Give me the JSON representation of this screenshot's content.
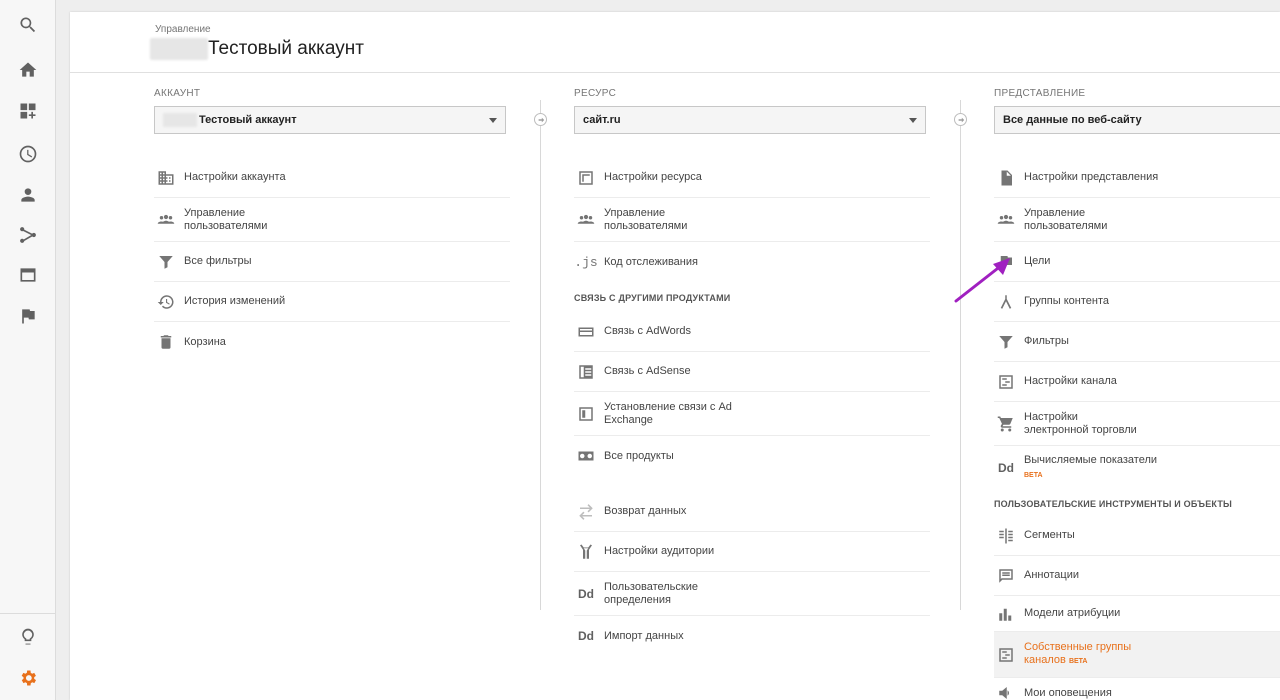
{
  "header": {
    "breadcrumb": "Управление",
    "title": "Тестовый аккаунт"
  },
  "nav_rail": [
    {
      "icon": "search-icon"
    },
    {
      "icon": "home-icon"
    },
    {
      "icon": "dashboard-icon"
    },
    {
      "icon": "clock-icon"
    },
    {
      "icon": "person-icon"
    },
    {
      "icon": "acquisition-icon"
    },
    {
      "icon": "browser-icon"
    },
    {
      "icon": "flag-icon"
    },
    {
      "icon": "lightbulb-icon"
    },
    {
      "icon": "gear-icon"
    }
  ],
  "account": {
    "label": "АККАУНТ",
    "selected": "Тестовый аккаунт",
    "items": [
      {
        "label": "Настройки аккаунта",
        "icon": "building-icon"
      },
      {
        "label": "Управление пользователями",
        "icon": "people-icon"
      },
      {
        "label": "Все фильтры",
        "icon": "filter-icon"
      },
      {
        "label": "История изменений",
        "icon": "history-icon"
      },
      {
        "label": "Корзина",
        "icon": "trash-icon"
      }
    ]
  },
  "property": {
    "label": "РЕСУРС",
    "selected": "сайт.ru",
    "items": [
      {
        "label": "Настройки ресурса",
        "icon": "window-icon"
      },
      {
        "label": "Управление пользователями",
        "icon": "people-icon"
      },
      {
        "label": "Код отслеживания",
        "icon": "js-icon",
        "glyph": ".js"
      }
    ],
    "section_title": "СВЯЗЬ С ДРУГИМИ ПРОДУКТАМИ",
    "links": [
      {
        "label": "Связь с AdWords",
        "icon": "adwords-icon"
      },
      {
        "label": "Связь с AdSense",
        "icon": "adsense-icon"
      },
      {
        "label": "Установление связи с Ad Exchange",
        "icon": "adexchange-icon"
      },
      {
        "label": "Все продукты",
        "icon": "products-icon"
      }
    ],
    "more": [
      {
        "label": "Возврат данных",
        "icon": "toggle-icon"
      },
      {
        "label": "Настройки аудитории",
        "icon": "audience-icon"
      },
      {
        "label": "Пользовательские определения",
        "icon": "dd-icon",
        "glyph": "Dd"
      },
      {
        "label": "Импорт данных",
        "icon": "dd-icon",
        "glyph": "Dd"
      }
    ]
  },
  "view": {
    "label": "ПРЕДСТАВЛЕНИЕ",
    "selected": "Все данные по веб-сайту",
    "items": [
      {
        "label": "Настройки представления",
        "icon": "document-icon"
      },
      {
        "label": "Управление пользователями",
        "icon": "people-icon"
      },
      {
        "label": "Цели",
        "icon": "flag-icon"
      },
      {
        "label": "Группы контента",
        "icon": "content-group-icon"
      },
      {
        "label": "Фильтры",
        "icon": "filter-icon"
      },
      {
        "label": "Настройки канала",
        "icon": "channel-icon"
      },
      {
        "label": "Настройки электронной торговли",
        "icon": "cart-icon"
      },
      {
        "label": "Вычисляемые показатели",
        "icon": "dd-icon",
        "glyph": "Dd",
        "badge": "BETA"
      }
    ],
    "section_title": "ПОЛЬЗОВАТЕЛЬСКИЕ ИНСТРУМЕНТЫ И ОБЪЕКТЫ",
    "tools": [
      {
        "label": "Сегменты",
        "icon": "segments-icon"
      },
      {
        "label": "Аннотации",
        "icon": "comment-icon"
      },
      {
        "label": "Модели атрибуции",
        "icon": "bar-chart-icon"
      },
      {
        "label": "Собственные группы каналов",
        "icon": "channel-icon",
        "badge": "BETA"
      },
      {
        "label": "Мои оповещения",
        "icon": "megaphone-icon"
      }
    ]
  },
  "colors": {
    "accent": "#e8711c",
    "annotation_arrow": "#a020c0"
  }
}
